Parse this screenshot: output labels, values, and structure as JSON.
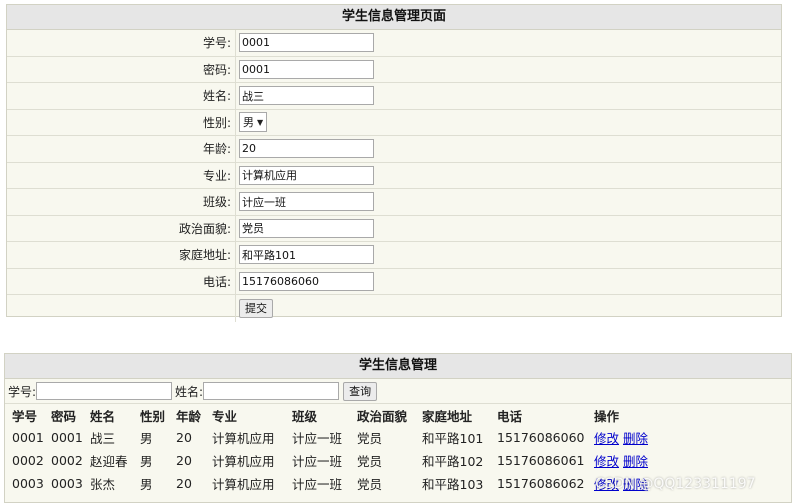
{
  "form": {
    "title": "学生信息管理页面",
    "fields": [
      {
        "label": "学号:",
        "value": "0001"
      },
      {
        "label": "密码:",
        "value": "0001"
      },
      {
        "label": "姓名:",
        "value": "战三"
      },
      {
        "label": "性别:",
        "value": "男"
      },
      {
        "label": "年龄:",
        "value": "20"
      },
      {
        "label": "专业:",
        "value": "计算机应用"
      },
      {
        "label": "班级:",
        "value": "计应一班"
      },
      {
        "label": "政治面貌:",
        "value": "党员"
      },
      {
        "label": "家庭地址:",
        "value": "和平路101"
      },
      {
        "label": "电话:",
        "value": "15176086060"
      }
    ],
    "submit_label": "提交"
  },
  "list": {
    "title": "学生信息管理",
    "search": {
      "id_label": "学号:",
      "id_value": "",
      "name_label": "姓名:",
      "name_value": "",
      "button_label": "查询"
    },
    "columns": [
      "学号",
      "密码",
      "姓名",
      "性别",
      "年龄",
      "专业",
      "班级",
      "政治面貌",
      "家庭地址",
      "电话",
      "操作"
    ],
    "rows": [
      {
        "id": "0001",
        "pwd": "0001",
        "name": "战三",
        "gender": "男",
        "age": "20",
        "major": "计算机应用",
        "cls": "计应一班",
        "political": "党员",
        "address": "和平路101",
        "phone": "15176086060",
        "edit": "修改",
        "del": "删除"
      },
      {
        "id": "0002",
        "pwd": "0002",
        "name": "赵迎春",
        "gender": "男",
        "age": "20",
        "major": "计算机应用",
        "cls": "计应一班",
        "political": "党员",
        "address": "和平路102",
        "phone": "15176086061",
        "edit": "修改",
        "del": "删除"
      },
      {
        "id": "0003",
        "pwd": "0003",
        "name": "张杰",
        "gender": "男",
        "age": "20",
        "major": "计算机应用",
        "cls": "计应一班",
        "political": "党员",
        "address": "和平路103",
        "phone": "15176086062",
        "edit": "修改",
        "del": "删除"
      }
    ]
  },
  "watermark": "CSDN @QQ123311197"
}
